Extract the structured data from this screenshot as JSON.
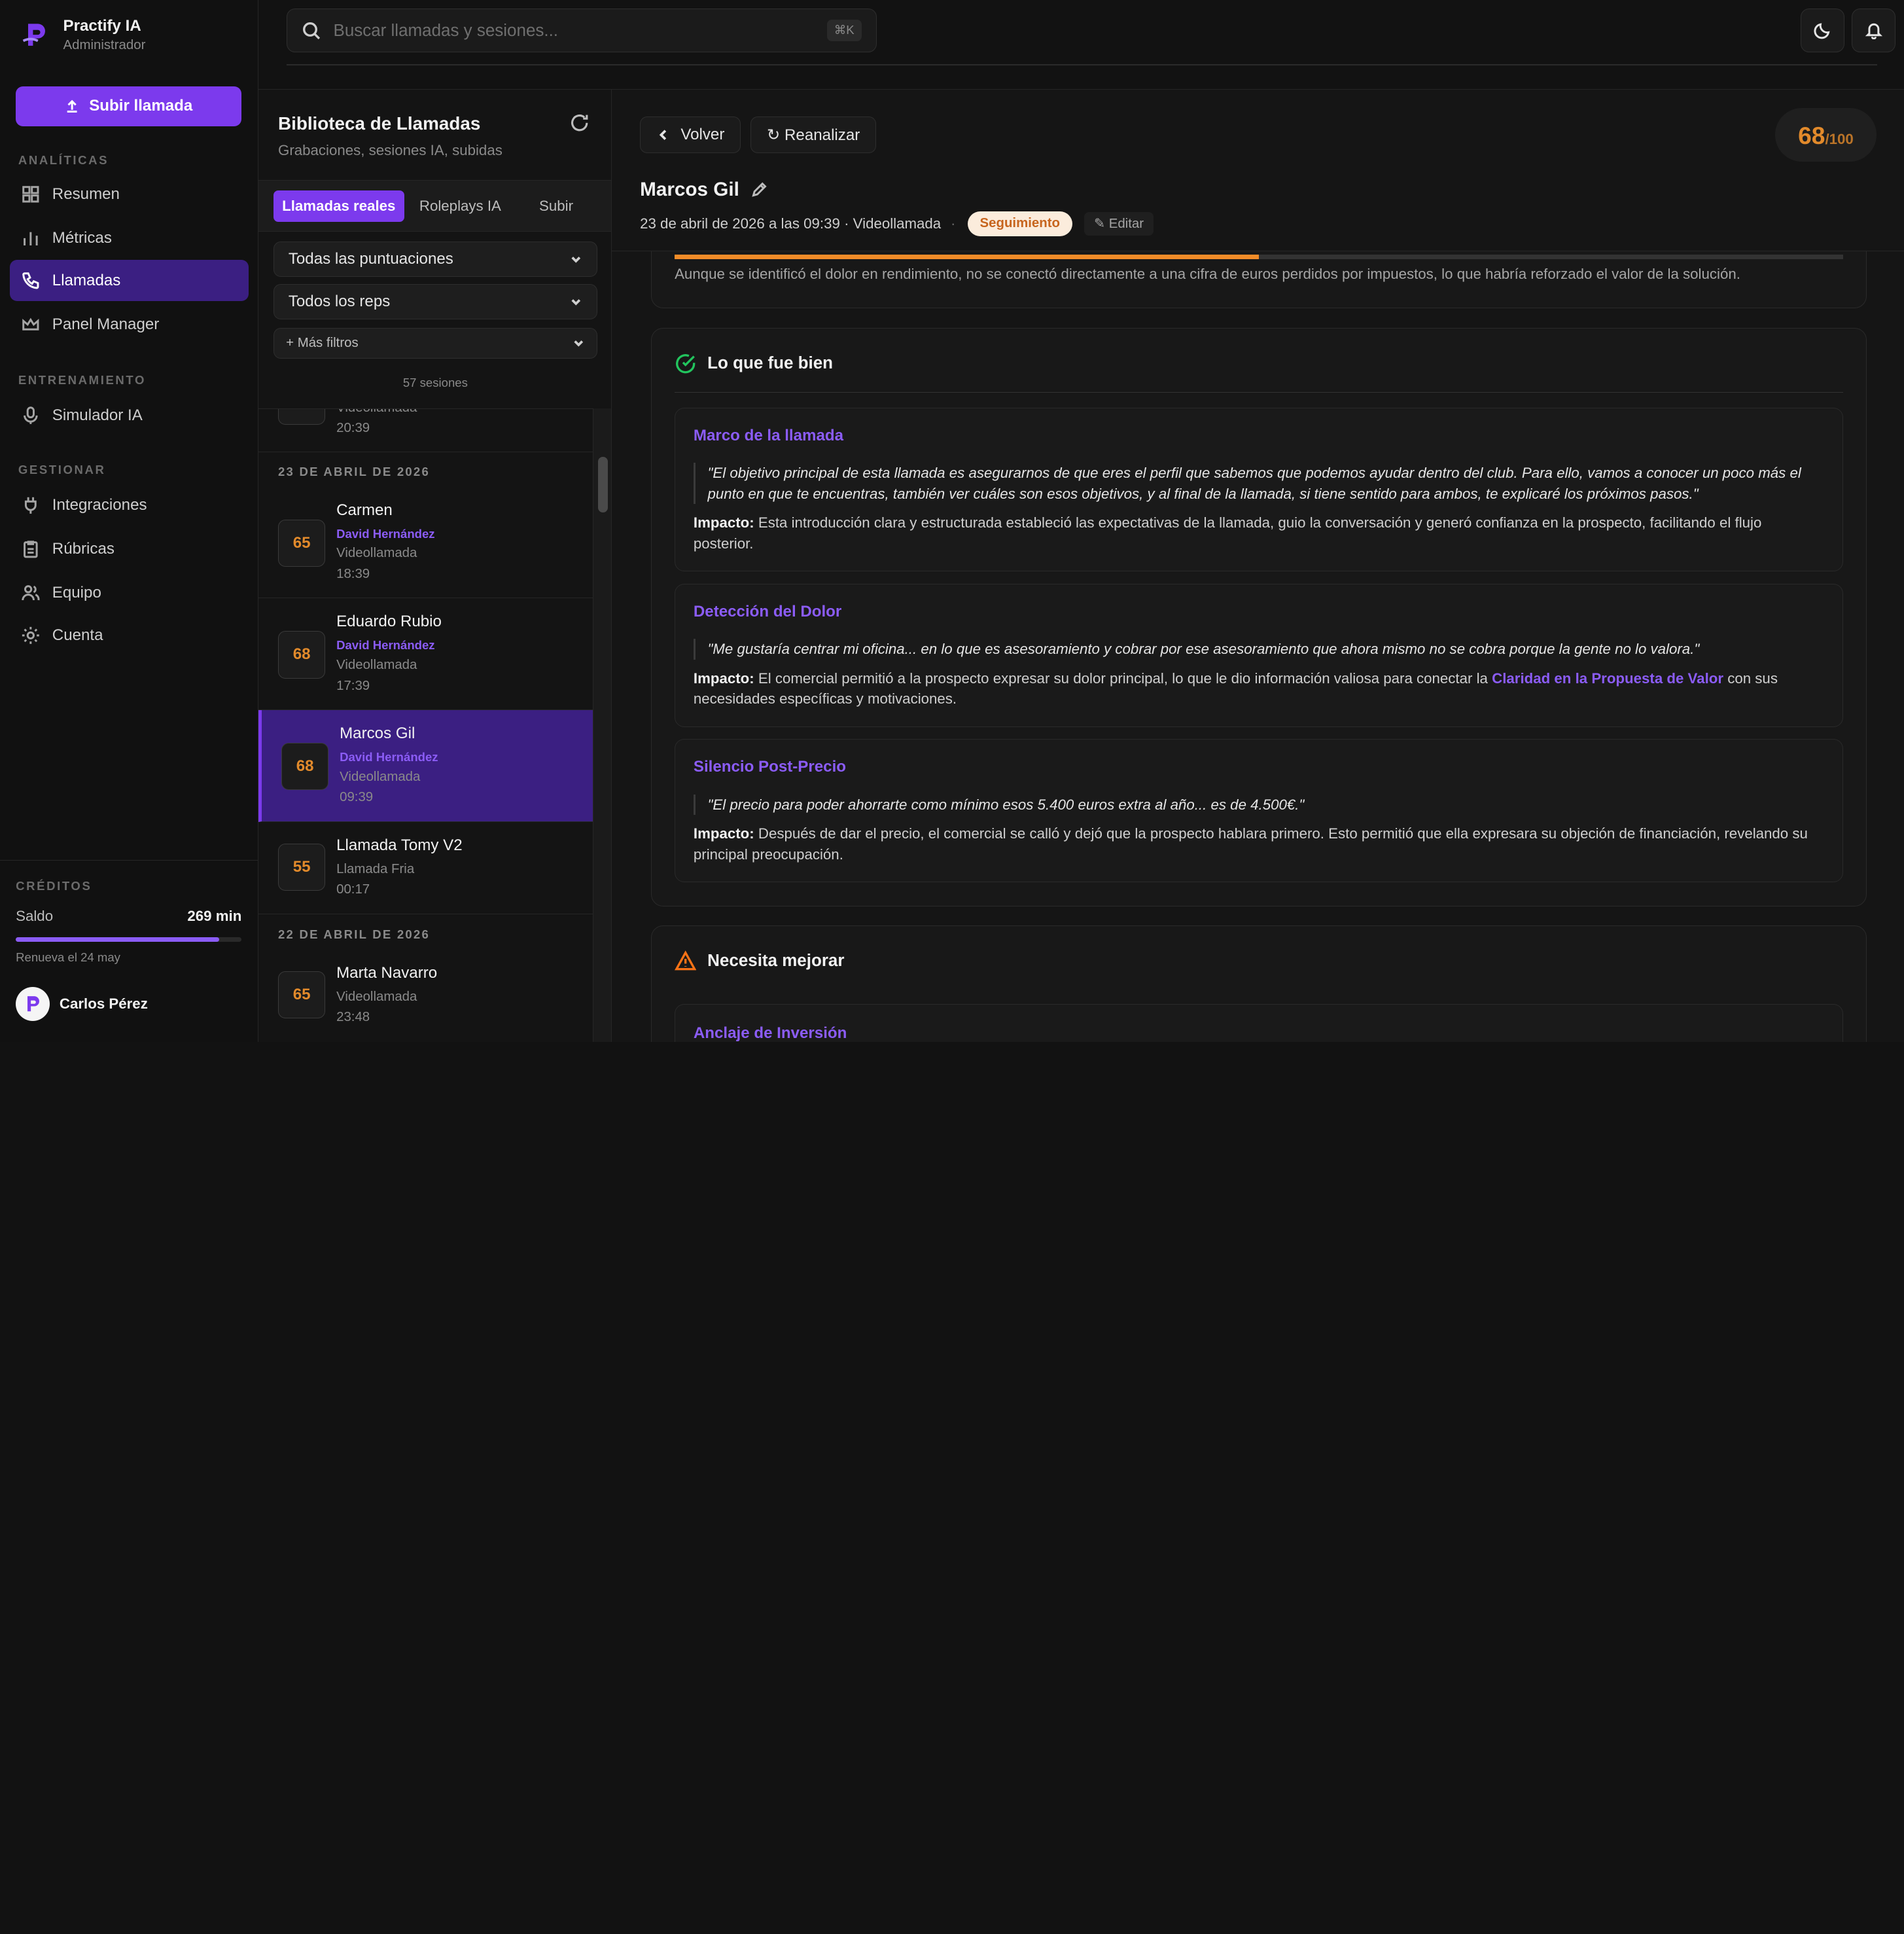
{
  "brand": {
    "name": "Practify IA",
    "role": "Administrador"
  },
  "sidebar": {
    "upload_label": "Subir llamada",
    "sections": {
      "analytics": "ANALÍTICAS",
      "training": "ENTRENAMIENTO",
      "manage": "GESTIONAR"
    },
    "items": {
      "summary": "Resumen",
      "metrics": "Métricas",
      "calls": "Llamadas",
      "manager": "Panel Manager",
      "simulator": "Simulador IA",
      "integrations": "Integraciones",
      "rubrics": "Rúbricas",
      "team": "Equipo",
      "account": "Cuenta"
    },
    "active_item": "calls"
  },
  "credits": {
    "title": "CRÉDITOS",
    "balance_label": "Saldo",
    "balance_value": "269 min",
    "fill_fraction": 0.9,
    "renew": "Renueva el 24 may",
    "user_name": "Carlos Pérez"
  },
  "topbar": {
    "search_placeholder": "Buscar llamadas y sesiones...",
    "shortcut": "⌘K"
  },
  "library": {
    "title": "Biblioteca de Llamadas",
    "subtitle": "Grabaciones, sesiones IA, subidas",
    "tabs": [
      "Llamadas reales",
      "Roleplays IA",
      "Subir"
    ],
    "active_tab": 0,
    "filter_scores": "Todas las puntuaciones",
    "filter_reps": "Todos los reps",
    "more_filters": "+ Más filtros",
    "sessions_count": "57 sesiones",
    "partial_item": {
      "type": "Videollamada",
      "time": "20:39"
    },
    "groups": [
      {
        "date": "23 DE ABRIL DE 2026",
        "items": [
          {
            "score": "65",
            "name": "Carmen",
            "rep": "David Hernández",
            "type": "Videollamada",
            "time": "18:39"
          },
          {
            "score": "68",
            "name": "Eduardo Rubio",
            "rep": "David Hernández",
            "type": "Videollamada",
            "time": "17:39"
          },
          {
            "score": "68",
            "name": "Marcos Gil",
            "rep": "David Hernández",
            "type": "Videollamada",
            "time": "09:39"
          },
          {
            "score": "55",
            "name": "Llamada Tomy V2",
            "type": "Llamada Fria",
            "time": "00:17"
          }
        ]
      },
      {
        "date": "22 DE ABRIL DE 2026",
        "items": [
          {
            "score": "65",
            "name": "Marta Navarro",
            "type": "Videollamada",
            "time": "23:48"
          }
        ]
      }
    ]
  },
  "detail": {
    "back_label": "Volver",
    "reanalyze_label": "↻ Reanalizar",
    "score": "68",
    "score_max": "/100",
    "name": "Marcos Gil",
    "meta": "23 de abril de 2026 a las 09:39 · Videollamada",
    "separator": "·",
    "status": "Seguimiento",
    "edit_label": "✎ Editar",
    "gap_progress": 0.5,
    "gap_text": "Aunque se identificó el dolor en rendimiento, no se conectó directamente a una cifra de euros perdidos por impuestos, lo que habría reforzado el valor de la solución.",
    "went_well": {
      "title": "Lo que fue bien",
      "items": [
        {
          "title": "Marco de la llamada",
          "quote": "\"El objetivo principal de esta llamada es asegurarnos de que eres el perfil que sabemos que podemos ayudar dentro del club. Para ello, vamos a conocer un poco más el punto en que te encuentras, también ver cuáles son esos objetivos, y al final de la llamada, si tiene sentido para ambos, te explicaré los próximos pasos.\"",
          "impact_label": "Impacto:",
          "impact": "Esta introducción clara y estructurada estableció las expectativas de la llamada, guio la conversación y generó confianza en la prospecto, facilitando el flujo posterior."
        },
        {
          "title": "Detección del Dolor",
          "quote": "\"Me gustaría centrar mi oficina... en lo que es asesoramiento y cobrar por ese asesoramiento que ahora mismo no se cobra porque la gente no lo valora.\"",
          "impact_label": "Impacto:",
          "impact_before": "El comercial permitió a la prospecto expresar su dolor principal, lo que le dio información valiosa para conectar la",
          "impact_link": "Claridad en la Propuesta de Valor",
          "impact_after": "con sus necesidades específicas y motivaciones."
        },
        {
          "title": "Silencio Post-Precio",
          "quote": "\"El precio para poder ahorrarte como mínimo esos 5.400 euros extra al año... es de 4.500€.\"",
          "impact_label": "Impacto:",
          "impact": "Después de dar el precio, el comercial se calló y dejó que la prospecto hablara primero. Esto permitió que ella expresara su objeción de financiación, revelando su principal preocupación."
        }
      ]
    },
    "improve": {
      "title": "Necesita mejorar",
      "first_item_title": "Anclaje de Inversión"
    }
  }
}
